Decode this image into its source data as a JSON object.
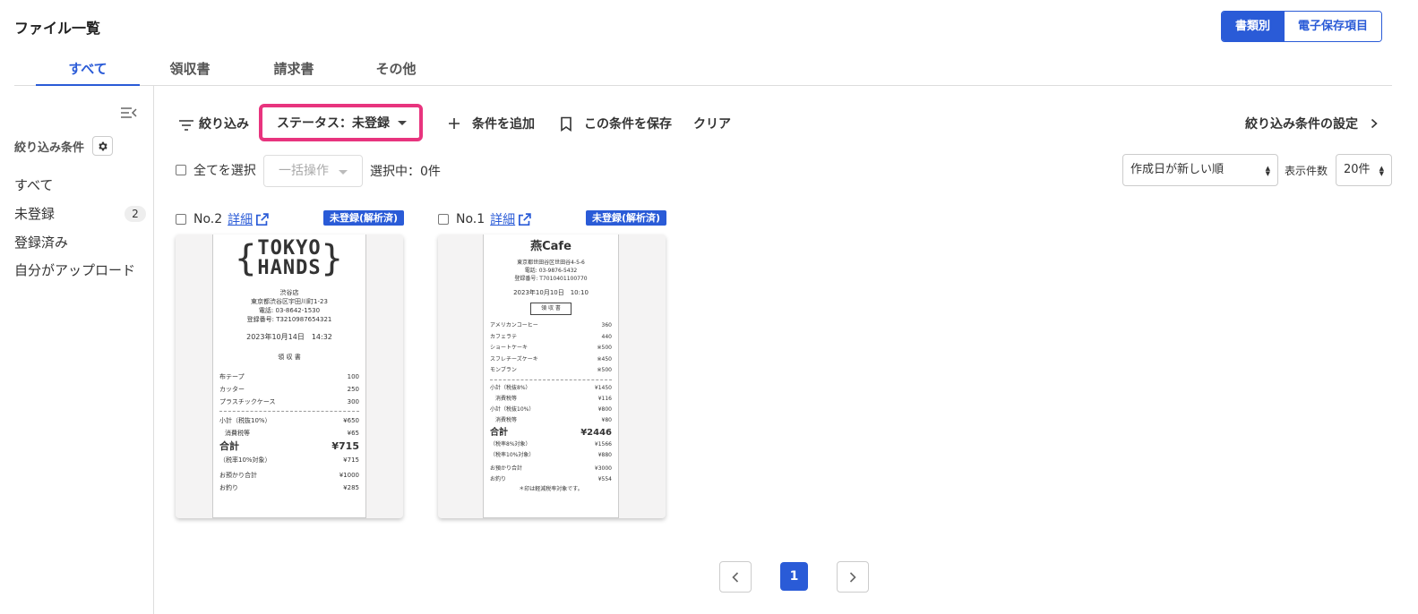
{
  "header": {
    "title": "ファイル一覧"
  },
  "view_toggle": {
    "by_type": "書類別",
    "e_storage": "電子保存項目"
  },
  "tabs": [
    {
      "label": "すべて"
    },
    {
      "label": "領収書"
    },
    {
      "label": "請求書"
    },
    {
      "label": "その他"
    }
  ],
  "sidebar": {
    "filter_title": "絞り込み条件",
    "items": [
      {
        "label": "すべて"
      },
      {
        "label": "未登録",
        "count": "2"
      },
      {
        "label": "登録済み"
      },
      {
        "label": "自分がアップロード"
      }
    ]
  },
  "toolbar": {
    "filter_label": "絞り込み",
    "status_filter": "ステータス：未登録",
    "add_condition": "条件を追加",
    "save_condition": "この条件を保存",
    "clear": "クリア",
    "filter_settings": "絞り込み条件の設定"
  },
  "selection": {
    "select_all": "全てを選択",
    "bulk_action": "一括操作",
    "selected_count": "選択中：0件"
  },
  "sort": {
    "value": "作成日が新しい順",
    "per_page_label": "表示件数",
    "per_page_value": "20件"
  },
  "cards": [
    {
      "no": "No.2",
      "detail": "詳細",
      "badge": "未登録(解析済)",
      "receipt": {
        "logo_line1": "TOKYO",
        "logo_line2": "HANDS",
        "store": "渋谷店",
        "address": "東京都渋谷区宇田川町1-23",
        "phone": "電話: 03-8642-1530",
        "reg_no": "登録番号: T3210987654321",
        "datetime": "2023年10月14日　14:32",
        "doc_title": "領 収 書",
        "items": [
          {
            "name": "布テープ",
            "price": "100"
          },
          {
            "name": "カッター",
            "price": "250"
          },
          {
            "name": "プラスチックケース",
            "price": "300"
          }
        ],
        "subtotal_label": "小計（税抜10%）",
        "subtotal": "¥650",
        "tax_label": "消費税等",
        "tax": "¥65",
        "total_label": "合計",
        "total": "¥715",
        "rate_label": "（税率10%対象）",
        "rate_value": "¥715",
        "paid_label": "お預かり合計",
        "paid": "¥1000",
        "change_label": "お釣り",
        "change": "¥285"
      }
    },
    {
      "no": "No.1",
      "detail": "詳細",
      "badge": "未登録(解析済)",
      "receipt": {
        "store": "燕Cafe",
        "address": "東京都世田谷区世田谷4-5-6",
        "phone": "電話: 03-9876-5432",
        "reg_no": "登録番号: T7010401100770",
        "datetime": "2023年10月10日　10:10",
        "doc_title": "領 収 書",
        "items": [
          {
            "name": "アメリカンコーヒー",
            "price": "360"
          },
          {
            "name": "カフェラテ",
            "price": "440"
          },
          {
            "name": "ショートケーキ",
            "price": "※500"
          },
          {
            "name": "スフレチーズケーキ",
            "price": "※450"
          },
          {
            "name": "モンブラン",
            "price": "※500"
          }
        ],
        "sub8_label": "小計（税抜8%）",
        "sub8": "¥1450",
        "tax8_label": "消費税等",
        "tax8": "¥116",
        "sub10_label": "小計（税抜10%）",
        "sub10": "¥800",
        "tax10_label": "消費税等",
        "tax10": "¥80",
        "total_label": "合計",
        "total": "¥2446",
        "rate8_label": "（税率8%対象）",
        "rate8": "¥1566",
        "rate10_label": "（税率10%対象）",
        "rate10": "¥880",
        "paid_label": "お預かり合計",
        "paid": "¥3000",
        "change_label": "お釣り",
        "change": "¥554",
        "note": "＊印は軽減税率対象です。"
      }
    }
  ],
  "pagination": {
    "current": "1"
  }
}
